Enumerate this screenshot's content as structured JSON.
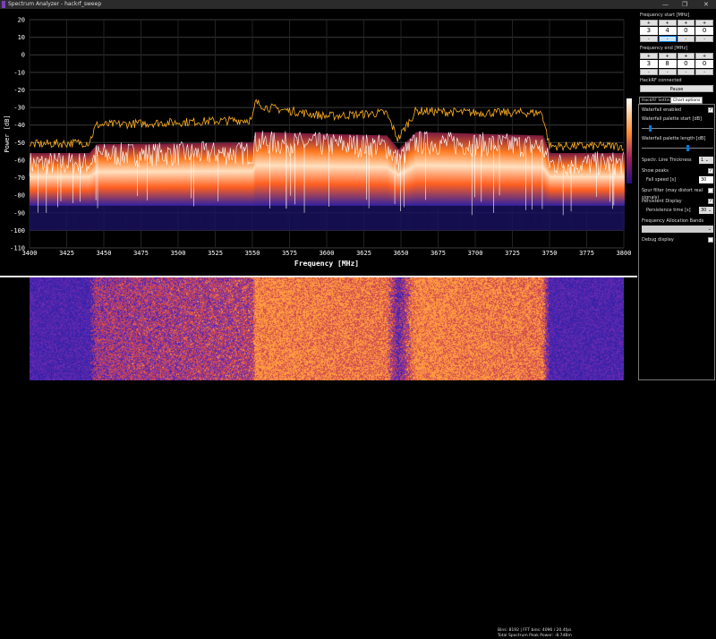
{
  "window": {
    "title": "Spectrum Analyzer - hackrf_sweep",
    "minimize": "—",
    "maximize": "❐",
    "close": "✕"
  },
  "sidebar": {
    "freq_start_label": "Frequency start [MHz]",
    "freq_start_digits": [
      "3",
      "4",
      "0",
      "0"
    ],
    "freq_end_label": "Frequency end [MHz]",
    "freq_end_digits": [
      "3",
      "8",
      "0",
      "0"
    ],
    "plus": "+",
    "minus": "-",
    "status": "HackRF connected",
    "pause_label": "Pause",
    "tabs": [
      {
        "label": "HackRF Settings",
        "active": false
      },
      {
        "label": "Chart options",
        "active": true
      }
    ],
    "options": {
      "waterfall_enabled": "Waterfall enabled",
      "waterfall_enabled_checked": true,
      "palette_start": "Waterfall palette start [dB]",
      "palette_start_level": 0.1,
      "palette_length": "Waterfall palette length [dB]",
      "palette_length_level": 0.65,
      "line_thickness": "Spectr. Line Thickness",
      "line_thickness_value": "1",
      "show_peaks": "Show peaks",
      "show_peaks_checked": true,
      "fall_speed": "Fall speed [s]",
      "fall_speed_value": "30",
      "spur_filter": "Spur filter (may distort real signals)",
      "spur_filter_checked": false,
      "persistent": "Persistent Display",
      "persistent_checked": true,
      "persistence_time": "Persistence time [s]",
      "persistence_time_value": "30",
      "alloc_bands": "Frequency Allocation Bands",
      "alloc_bands_value": "",
      "debug": "Debug display",
      "debug_checked": false,
      "check": "✓",
      "dropdown": "⌄"
    }
  },
  "overlay": {
    "line1": "Bins: 8192 | FFT bins: 4096 / 20.4fps",
    "line2": "Total Spectrum Peak Power: -8.7dBm"
  },
  "chart_data": {
    "type": "line",
    "xlabel": "Frequency [MHz]",
    "ylabel": "Power [dB]",
    "xlim": [
      3400,
      3800
    ],
    "ylim": [
      -110,
      20
    ],
    "xticks": [
      3400,
      3425,
      3450,
      3475,
      3500,
      3525,
      3550,
      3575,
      3600,
      3625,
      3650,
      3675,
      3700,
      3725,
      3750,
      3775,
      3800
    ],
    "yticks": [
      20,
      10,
      0,
      -10,
      -20,
      -30,
      -40,
      -50,
      -60,
      -70,
      -80,
      -90,
      -100,
      -110
    ],
    "grid": true,
    "series": [
      {
        "role": "peak",
        "color": "#ffb020",
        "x": [
          3400,
          3440,
          3445,
          3550,
          3552,
          3560,
          3600,
          3640,
          3648,
          3660,
          3700,
          3745,
          3750,
          3800
        ],
        "y": [
          -51,
          -50,
          -40,
          -37,
          -27,
          -30,
          -35,
          -33,
          -48,
          -32,
          -33,
          -33,
          -52,
          -52
        ]
      },
      {
        "role": "spectrum",
        "color": "#ffffff",
        "x": [
          3400,
          3440,
          3445,
          3550,
          3552,
          3640,
          3648,
          3660,
          3745,
          3750,
          3800
        ],
        "y": [
          -62,
          -62,
          -57,
          -56,
          -50,
          -52,
          -60,
          -50,
          -52,
          -62,
          -62
        ]
      },
      {
        "role": "floor",
        "color": "#2020a0",
        "x": [
          3400,
          3800
        ],
        "y": [
          -85,
          -85
        ]
      }
    ],
    "colors": {
      "grid": "#3a3a3a",
      "axis_text": "#ffffff",
      "waterfall_low": "#2a1a9a",
      "waterfall_high": "#ff8a20"
    }
  }
}
